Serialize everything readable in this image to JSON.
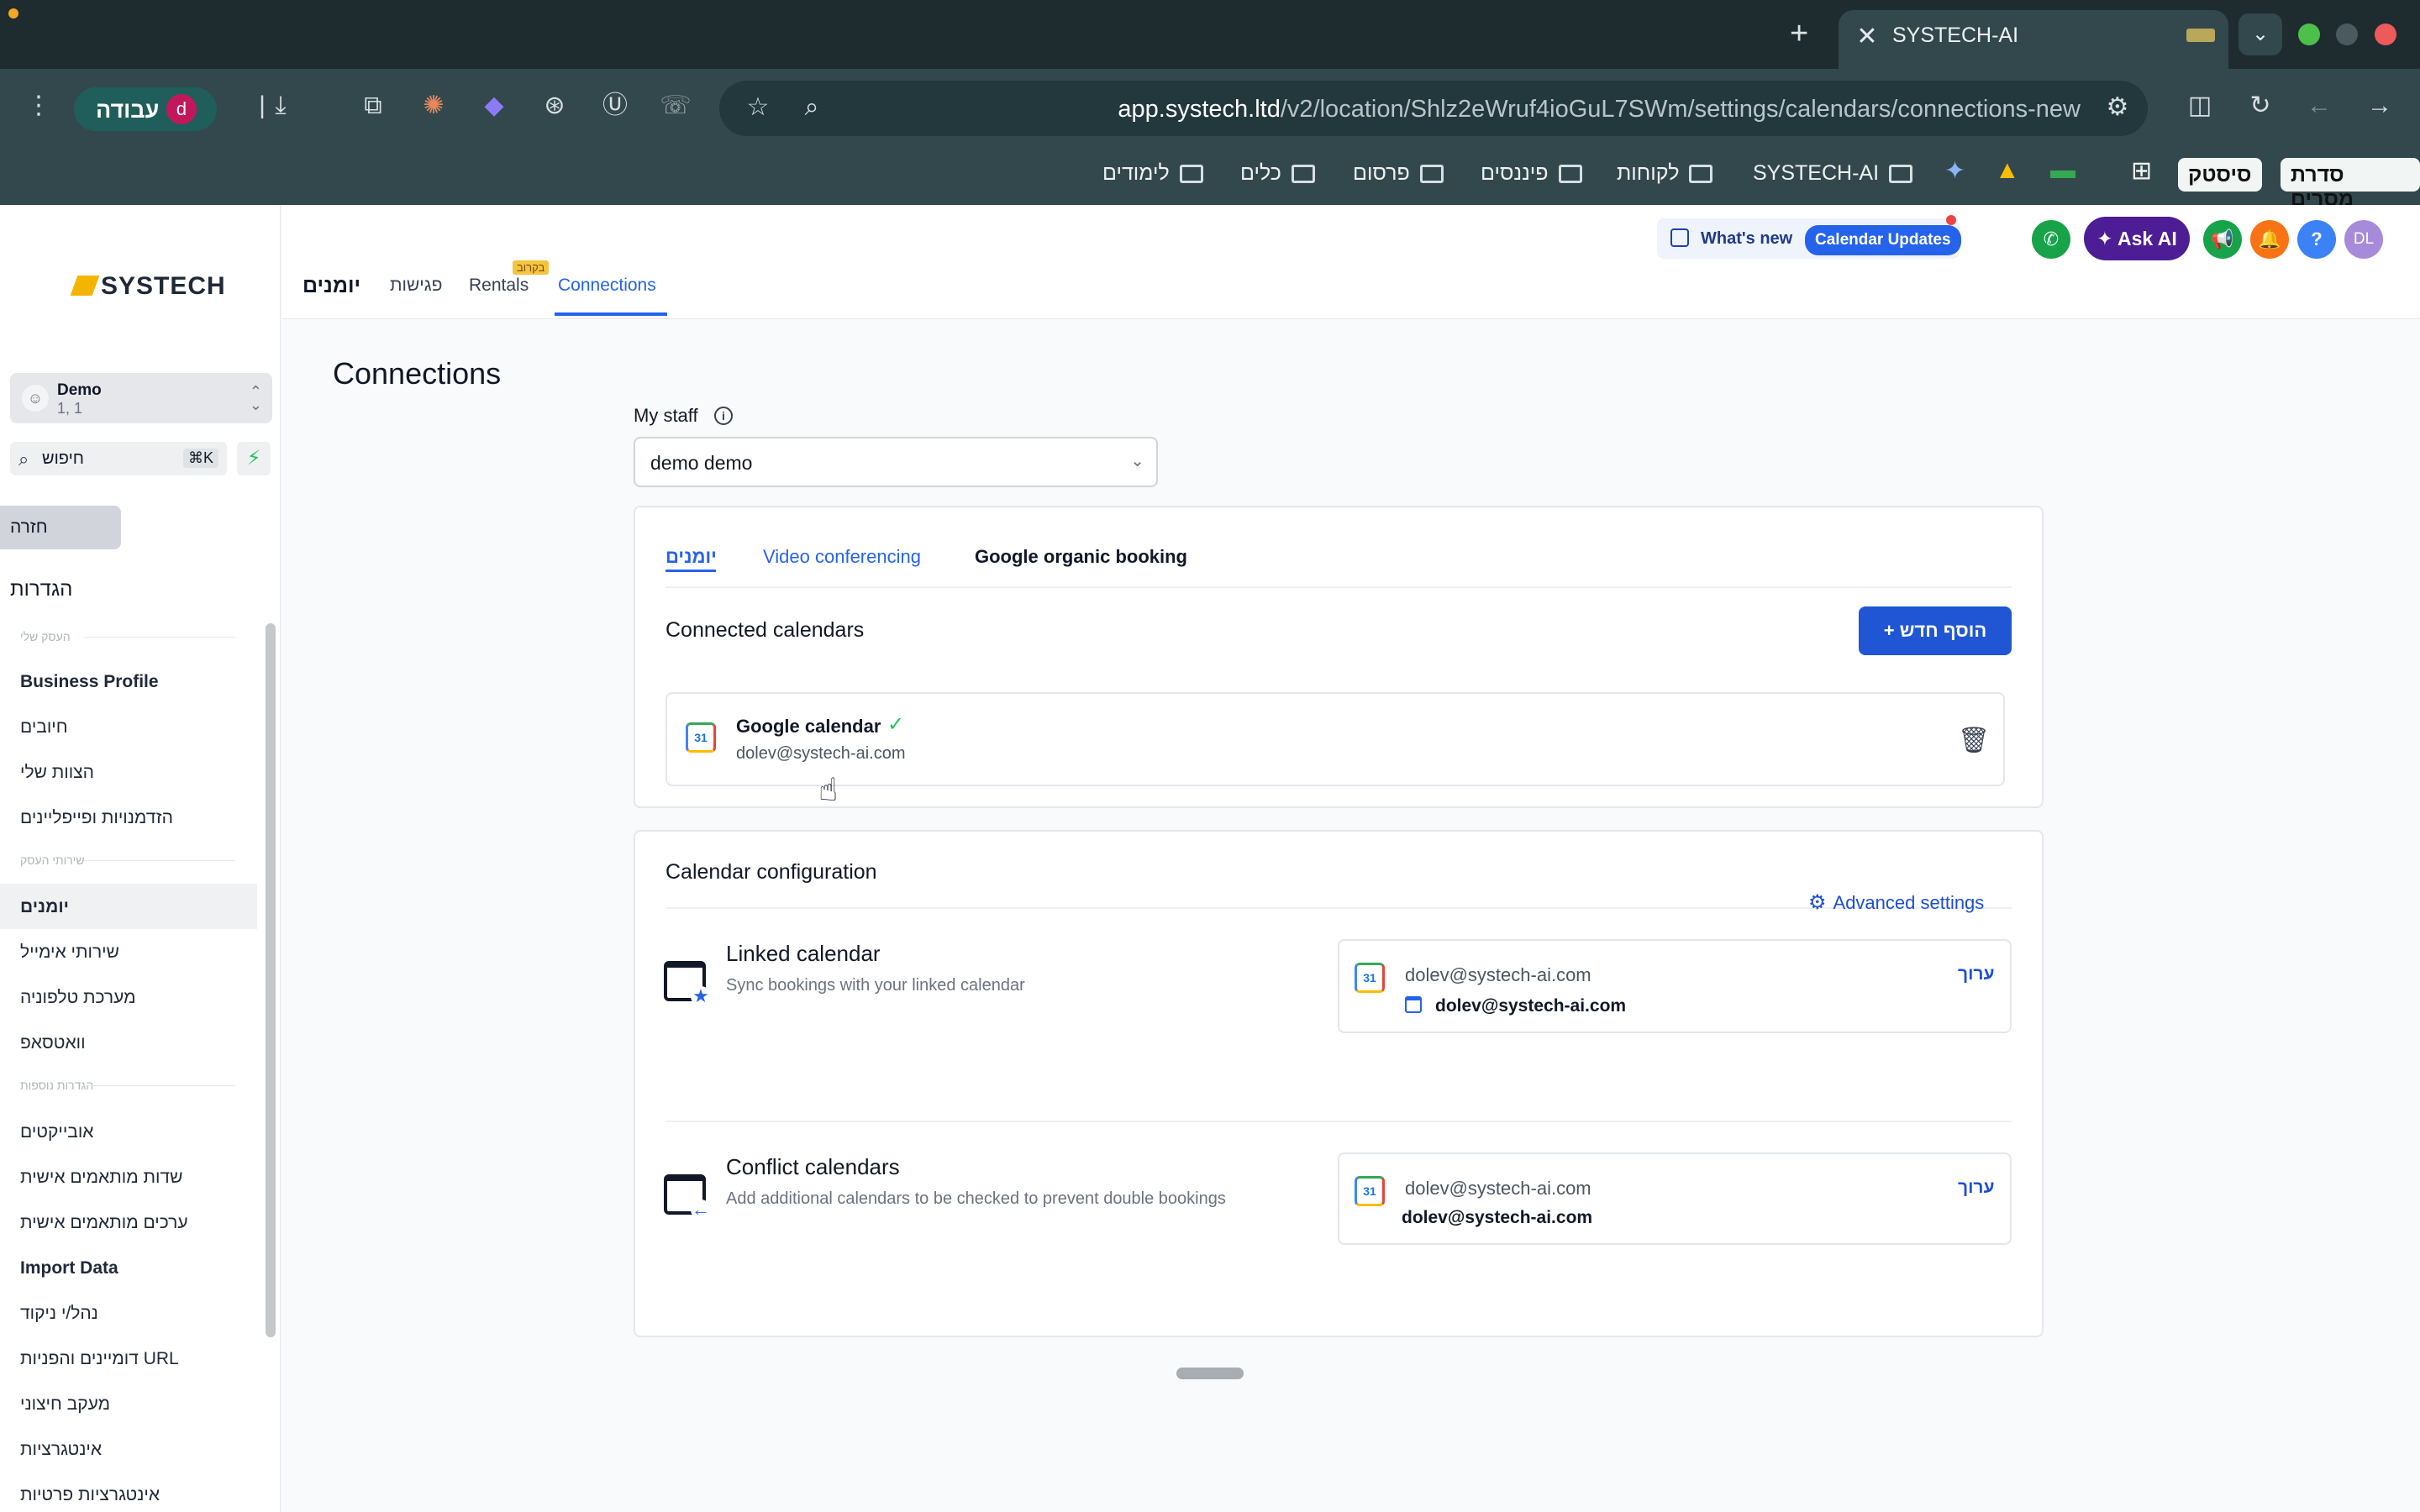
{
  "browser": {
    "tab_title": "SYSTECH-AI",
    "new_tab": "+",
    "tab_close": "✕",
    "profile_label": "עבודה",
    "profile_initial": "d",
    "url_host": "app.systech.ltd",
    "url_path": "/v2/location/Shlz2eWruf4ioGuL7SWm/settings/calendars/connections-new",
    "bookmarks": [
      "לימודים",
      "כלים",
      "פרסום",
      "פיננסים",
      "לקוחות",
      "SYSTECH-AI"
    ],
    "bookmark_boxes": [
      "סיסטק",
      "סדרת מסרים"
    ]
  },
  "sidebar": {
    "logo": "SYSTECH",
    "location_name": "Demo",
    "location_sub": "1, 1",
    "search_placeholder": "חיפוש",
    "search_shortcut": "⌘K",
    "back_label": "חזרה",
    "settings_title": "הגדרות",
    "section_1": "העסק שלי",
    "section_2": "שירותי העסק",
    "section_3": "הגדרות נוספות",
    "items": [
      "Business Profile",
      "חיובים",
      "הצוות שלי",
      "הזדמנויות ופייפליינים",
      "יומנים",
      "שירותי אימייל",
      "מערכת טלפוניה",
      "וואטסאפ",
      "אובייקטים",
      "שדות מותאמים אישית",
      "ערכים מותאמים אישית",
      "Import Data",
      "נהל/י ניקוד",
      "דומיינים והפניות URL",
      "מעקב חיצוני",
      "אינטגרציות",
      "אינטגרציות פרטיות"
    ]
  },
  "header": {
    "title": "יומנים",
    "tabs": [
      "פגישות",
      "Rentals",
      "Connections"
    ],
    "soon_badge": "בקרוב",
    "whats_new": "What's new",
    "calendar_updates": "Calendar Updates",
    "ask_ai": "Ask AI",
    "avatar": "DL",
    "help": "?"
  },
  "page": {
    "title": "Connections",
    "staff_label": "My staff",
    "staff_value": "demo demo",
    "tabs": [
      "יומנים",
      "Video conferencing",
      "Google organic booking"
    ],
    "connected_title": "Connected calendars",
    "add_button": "+ הוסף חדש",
    "google_calendar_name": "Google calendar",
    "google_calendar_email": "dolev@systech-ai.com",
    "config_title": "Calendar configuration",
    "linked": {
      "title": "Linked calendar",
      "desc": "Sync bookings with your linked calendar",
      "account": "dolev@systech-ai.com",
      "calendar": "dolev@systech-ai.com",
      "edit": "ערוך"
    },
    "advanced_settings": "Advanced settings",
    "conflict": {
      "title": "Conflict calendars",
      "desc": "Add additional calendars to be checked to prevent double bookings",
      "account": "dolev@systech-ai.com",
      "calendar": "dolev@systech-ai.com",
      "edit": "ערוך"
    }
  },
  "icons": {
    "gcal_label": "31",
    "check": "✓",
    "trash": "🗑",
    "gear": "⚙",
    "info": "i"
  }
}
